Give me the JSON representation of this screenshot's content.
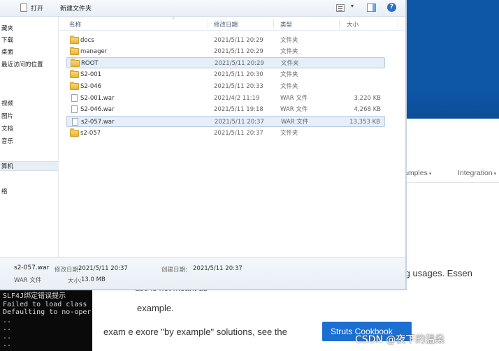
{
  "toolbar": {
    "open_label": "打开",
    "new_folder_label": "新建文件夹",
    "view_icon": "view-options-icon",
    "pane_icon": "preview-pane-icon",
    "help_icon": "help-icon",
    "help_glyph": "?"
  },
  "sidebar": {
    "items": [
      {
        "label": "藏夹"
      },
      {
        "label": "下载"
      },
      {
        "label": "桌面"
      },
      {
        "label": "最近访问的位置"
      },
      {
        "label": "视频"
      },
      {
        "label": "图片"
      },
      {
        "label": "文档"
      },
      {
        "label": "音乐"
      },
      {
        "label": "算机"
      },
      {
        "label": "络"
      }
    ]
  },
  "list": {
    "columns": [
      "名称",
      "修改日期",
      "类型",
      "大小"
    ],
    "rows": [
      {
        "name": "docs",
        "date": "2021/5/11 20:29",
        "type": "文件夹",
        "size": "",
        "kind": "folder"
      },
      {
        "name": "manager",
        "date": "2021/5/11 20:29",
        "type": "文件夹",
        "size": "",
        "kind": "folder"
      },
      {
        "name": "ROOT",
        "date": "2021/5/11 20:29",
        "type": "文件夹",
        "size": "",
        "kind": "folder"
      },
      {
        "name": "S2-001",
        "date": "2021/5/11 20:30",
        "type": "文件夹",
        "size": "",
        "kind": "folder"
      },
      {
        "name": "S2-046",
        "date": "2021/5/11 20:33",
        "type": "文件夹",
        "size": "",
        "kind": "folder"
      },
      {
        "name": "S2-001.war",
        "date": "2021/4/2 11:19",
        "type": "WAR 文件",
        "size": "3,220 KB",
        "kind": "file"
      },
      {
        "name": "S2-046.war",
        "date": "2021/5/11 19:18",
        "type": "WAR 文件",
        "size": "4,268 KB",
        "kind": "file"
      },
      {
        "name": "s2-057.war",
        "date": "2021/5/11 20:37",
        "type": "WAR 文件",
        "size": "13,353 KB",
        "kind": "file"
      },
      {
        "name": "s2-057",
        "date": "2021/5/11 20:37",
        "type": "文件夹",
        "size": "",
        "kind": "folder"
      }
    ]
  },
  "details": {
    "name": "s2-057.war",
    "type": "WAR 文件",
    "modified_label": "修改日期:",
    "modified_value": "2021/5/11 20:37",
    "size_label": "大小:",
    "size_value": "13.0 MB",
    "created_label": "创建日期:",
    "created_value": "2021/5/11 20:37"
  },
  "background": {
    "nav_examples": "amples",
    "nav_integration": "Integration",
    "line1": "d tag usages. Essen",
    "line2": "ase is not meant as",
    "line3": "example.",
    "line4": "exam e exore \"by example\" solutions, see the",
    "cookbook_button": "Struts Cookbook",
    "watermark": "CSDN @夜下的温柔"
  },
  "terminal": {
    "lines": [
      "SLF4J绑定错误提示",
      "Failed to load class",
      "Defaulting to no-oper",
      " ..",
      " ..",
      " ..",
      " .."
    ]
  }
}
